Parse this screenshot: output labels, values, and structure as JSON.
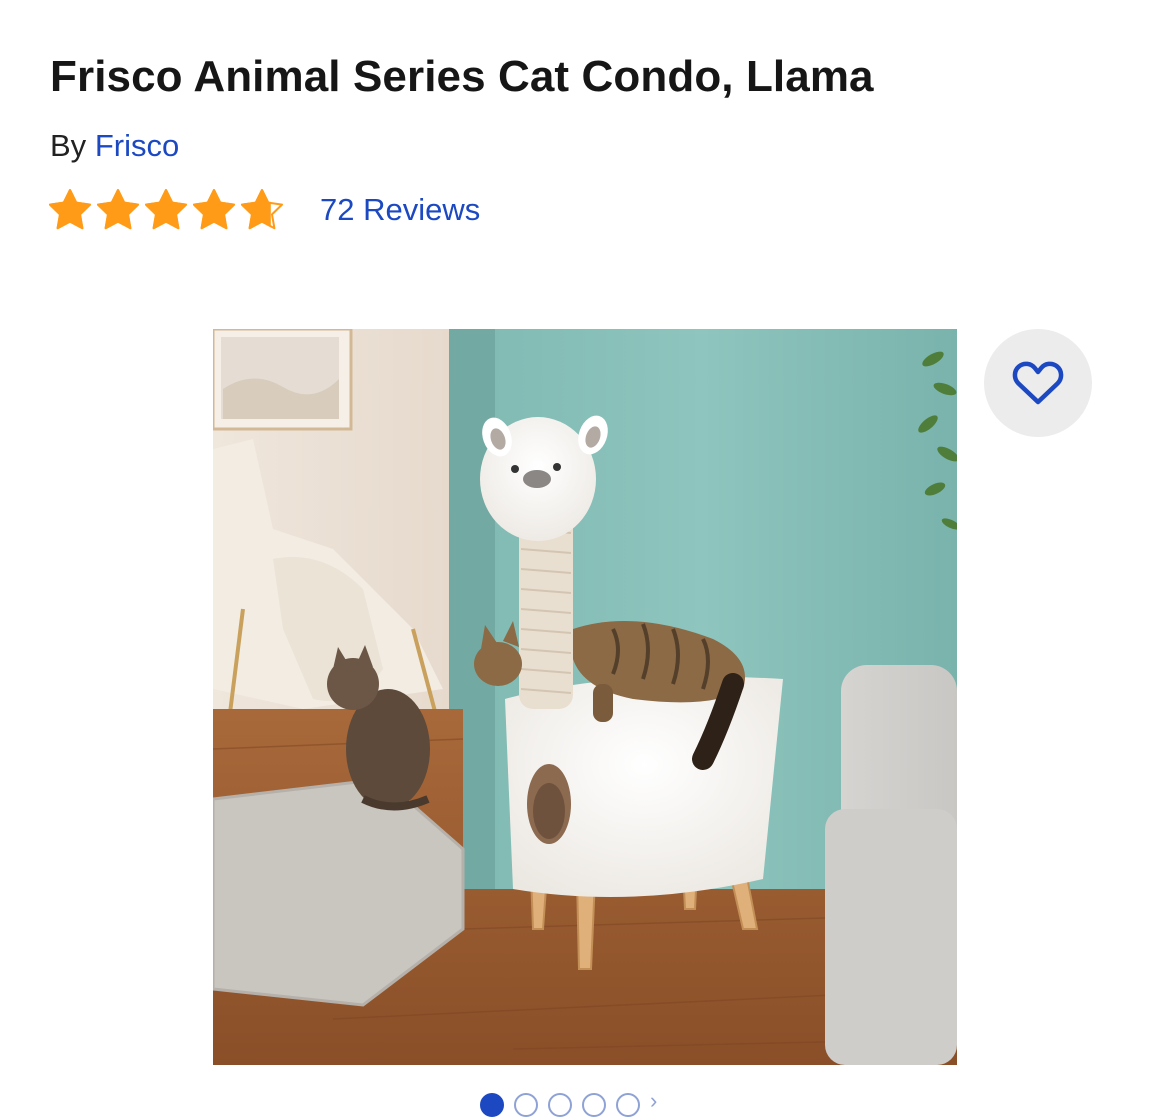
{
  "product": {
    "title": "Frisco Animal Series Cat Condo, Llama",
    "by_label": "By",
    "brand": "Frisco",
    "rating": 4.7,
    "rating_max": 5,
    "reviews_label": "72 Reviews"
  },
  "gallery": {
    "image_count": 5,
    "active_index": 0
  },
  "icons": {
    "star": "star-icon",
    "favorite": "heart-outline-icon"
  },
  "colors": {
    "star": "#ff9b17",
    "link": "#1c49c2",
    "fav_bg": "#ececec"
  }
}
